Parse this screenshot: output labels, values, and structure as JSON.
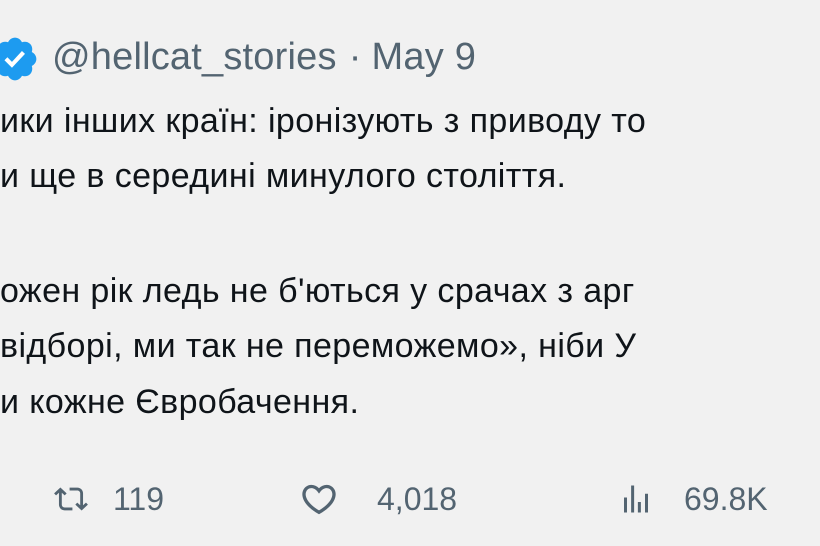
{
  "tweet": {
    "handle": "@hellcat_stories",
    "separator": "·",
    "date": "May 9",
    "lines": [
      "ики інших країн: іронізують з приводу то",
      "и ще в середині минулого століття.",
      "ожен рік ледь не б'ються у срачах з арг",
      " відборі, ми так не переможемо», ніби У",
      "и кожне Євробачення."
    ]
  },
  "actions": {
    "retweets": "119",
    "likes": "4,018",
    "views": "69.8K"
  },
  "icons": {
    "verified": "verified-badge-icon",
    "retweet": "retweet-icon",
    "like": "heart-icon",
    "views": "views-chart-icon"
  },
  "colors": {
    "background": "#f1f1f1",
    "text": "#0f1419",
    "muted": "#536471",
    "verified": "#1d9bf0"
  }
}
